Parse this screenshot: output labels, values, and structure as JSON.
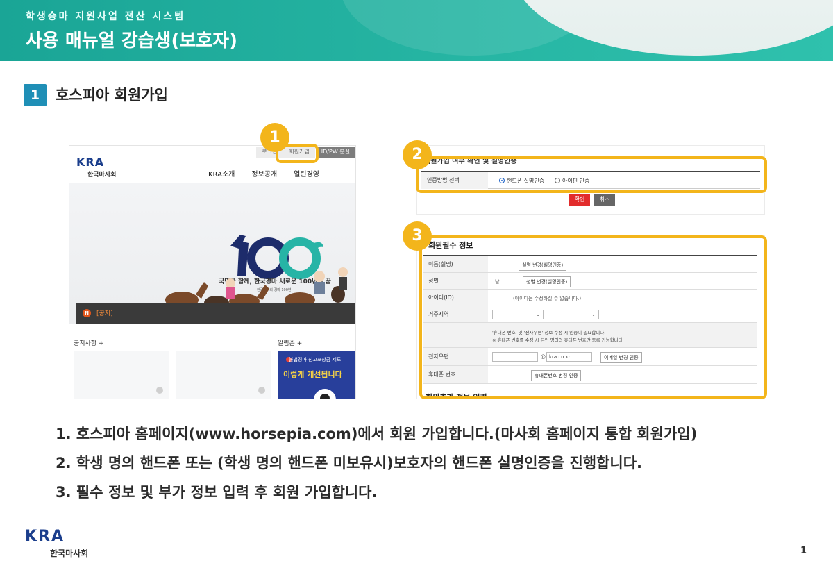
{
  "header": {
    "subtitle": "학생승마 지원사업 전산 시스템",
    "title": "사용 매뉴얼 강습생(보호자)"
  },
  "section": {
    "number": "1",
    "title": "호스피아 회원가입"
  },
  "callouts": [
    "1",
    "2",
    "3"
  ],
  "homepage": {
    "top_buttons": [
      "로그인",
      "회원가입",
      "ID/PW 분실"
    ],
    "logo_word": "KRA",
    "logo_ko": "한국마사회",
    "nav": [
      "KRA소개",
      "정보공개",
      "열린경영"
    ],
    "hero_number": "100",
    "slogan": "국민과 함께, 한국경마 새로운 100년의 꿈",
    "slogan_sub": "한국마사회 경마 100년",
    "notice_badge": "N",
    "notice_text": "[공지]",
    "label_notice": "공지사항 +",
    "label_alarm": "알림존 +",
    "promo_line1": "불법경마 신고포상금 제도",
    "promo_line2": "이렇게 개선됩니다"
  },
  "auth_form": {
    "heading": "회원가입 여부 확인 및 실명인증",
    "row_label": "인증방법 선택",
    "options": [
      "핸드폰 실명인증",
      "아이핀 인증"
    ],
    "confirm": "확인",
    "cancel": "취소"
  },
  "member_form": {
    "heading": "회원필수 정보",
    "rows": {
      "name": {
        "label": "이름(실명)",
        "button": "실명 변경(실명인증)"
      },
      "gender": {
        "label": "성별",
        "value": "남",
        "button": "성별 변경(실명인증)"
      },
      "id": {
        "label": "아이디(ID)",
        "note": "(아이디는 수정하실 수 없습니다.)"
      },
      "region": {
        "label": "거주지역"
      },
      "notes": {
        "line1": "'휴대폰 번호' 및 '전자우편' 정보 수정 시 인증이 필요합니다.",
        "line2": "※ 휴대폰 번호를 수정 시 본인 명의의 휴대폰 번호만 등록 가능합니다."
      },
      "email": {
        "label": "전자우편",
        "at": "@",
        "domain": "kra.co.kr",
        "button": "이메일 변경 인증"
      },
      "phone": {
        "label": "휴대폰 번호",
        "button": "휴대폰번호 변경 인증"
      }
    },
    "next_heading": "회원추가 정보 입력"
  },
  "steps": [
    "1. 호스피아 홈페이지(www.horsepia.com)에서 회원 가입합니다.(마사회 홈페이지 통합 회원가입)",
    "2. 학생 명의 핸드폰 또는 (학생 명의 핸드폰 미보유시)보호자의 핸드폰 실명인증을 진행합니다.",
    "3. 필수 정보 및 부가 정보 입력 후 회원 가입합니다."
  ],
  "footer": {
    "logo_word": "KRA",
    "logo_ko": "한국마사회",
    "page": "1"
  },
  "colors": {
    "teal": "#1aa596",
    "accent_yellow": "#f3b51b",
    "section_blue": "#1f8fb6",
    "kra_navy": "#1b3e8c"
  }
}
